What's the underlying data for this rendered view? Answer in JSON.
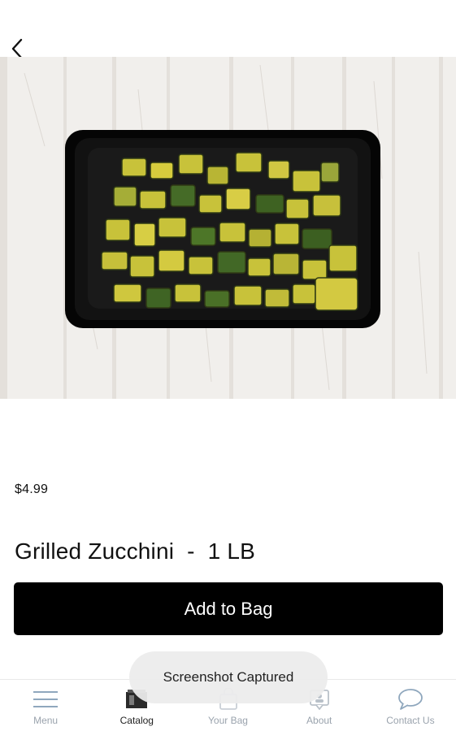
{
  "product": {
    "image_alt": "Grilled zucchini in a black container",
    "price": "$4.99",
    "title": "Grilled Zucchini  -  1 LB"
  },
  "actions": {
    "add_to_bag": "Add to Bag"
  },
  "tabbar": {
    "items": [
      {
        "label": "Menu",
        "icon": "hamburger-menu-icon",
        "active": false
      },
      {
        "label": "Catalog",
        "icon": "catalog-icon",
        "active": true
      },
      {
        "label": "Your Bag",
        "icon": "shopping-bag-icon",
        "active": false
      },
      {
        "label": "About",
        "icon": "about-icon",
        "active": false
      },
      {
        "label": "Contact Us",
        "icon": "chat-bubble-icon",
        "active": false
      }
    ]
  },
  "toast": {
    "message": "Screenshot Captured"
  },
  "colors": {
    "button_bg": "#000000",
    "button_text": "#ffffff",
    "tab_inactive": "#9aa3ad",
    "tab_active": "#222222"
  }
}
